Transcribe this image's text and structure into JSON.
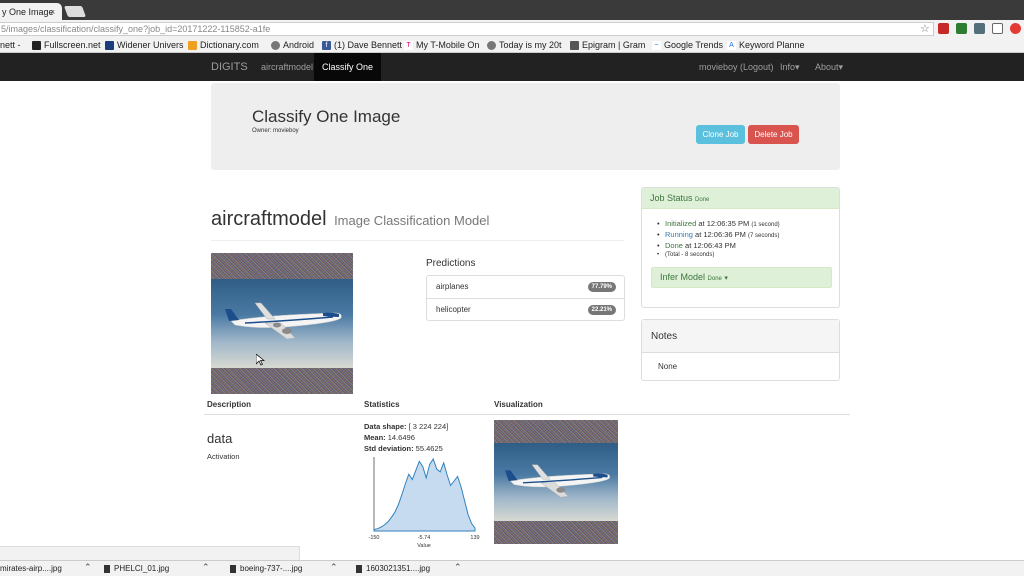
{
  "browser": {
    "tab_title": "y One Image",
    "tab_close": "×",
    "url": "5/images/classification/classify_one?job_id=20171222-115852-a1fe",
    "bookmarks": [
      "nett -",
      "Fullscreen.net",
      "Widener Univers",
      "Dictionary.com",
      "Android",
      "(1) Dave Bennett",
      "My T-Mobile On",
      "Today is my 20t",
      "Epigram | Gram",
      "Google Trends",
      "Keyword Planne"
    ]
  },
  "navbar": {
    "brand": "DIGITS",
    "items": [
      "aircraftmodel",
      "Classify One"
    ],
    "user": "movieboy (Logout)",
    "info": "Info",
    "about": "About"
  },
  "header": {
    "title": "Classify One Image",
    "owner": "Owner: movieboy",
    "clone_label": "Clone Job",
    "delete_label": "Delete Job"
  },
  "model": {
    "name": "aircraftmodel",
    "subtitle": "Image Classification Model"
  },
  "predictions": {
    "title": "Predictions",
    "rows": [
      {
        "label": "airplanes",
        "value": "77.79%"
      },
      {
        "label": "helicopter",
        "value": "22.21%"
      }
    ]
  },
  "job_status": {
    "title": "Job Status",
    "state": "Done",
    "events": [
      {
        "label": "Initialized",
        "time": " at 12:06:35 PM ",
        "dur": "(1 second)"
      },
      {
        "label": "Running",
        "time": " at 12:06:36 PM ",
        "dur": "(7 seconds)"
      },
      {
        "label": "Done",
        "time": " at 12:06:43 PM",
        "dur": ""
      }
    ],
    "total": "(Total - 8 seconds)",
    "infer_label": "Infer Model",
    "infer_state": "Done"
  },
  "notes": {
    "title": "Notes",
    "body": "None"
  },
  "layers": {
    "headers": {
      "description": "Description",
      "statistics": "Statistics",
      "visualization": "Visualization"
    },
    "name": "data",
    "type": "Activation",
    "shape_label": "Data shape:",
    "shape_value": " [ 3 224 224]",
    "mean_label": "Mean:",
    "mean_value": " 14.6496",
    "std_label": "Std deviation:",
    "std_value": " 55.4625",
    "histogram": {
      "x_ticks": [
        "-150",
        "-5.74",
        "139"
      ],
      "xlabel": "Value",
      "values": [
        2,
        3,
        5,
        8,
        12,
        18,
        25,
        35,
        48,
        62,
        75,
        68,
        80,
        92,
        85,
        70,
        88,
        95,
        82,
        78,
        90,
        74,
        60,
        66,
        72,
        58,
        40,
        22,
        10,
        4
      ]
    }
  },
  "downloads": [
    "mirates-airp....jpg",
    "PHELCI_01.jpg",
    "boeing-737-....jpg",
    "1603021351....jpg"
  ],
  "colors": {
    "navbar": "#222222",
    "success": "#dff0d8",
    "info_button": "#5bc0de",
    "danger_button": "#d9534f"
  }
}
